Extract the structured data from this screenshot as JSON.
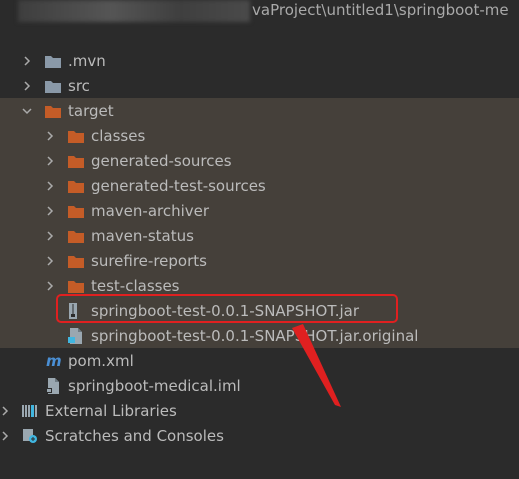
{
  "header": {
    "path_text": "vaProject\\untitled1\\springboot-me"
  },
  "tree": {
    "mvn": ".mvn",
    "src": "src",
    "target": "target",
    "classes": "classes",
    "generated_sources": "generated-sources",
    "generated_test_sources": "generated-test-sources",
    "maven_archiver": "maven-archiver",
    "maven_status": "maven-status",
    "surefire_reports": "surefire-reports",
    "test_classes": "test-classes",
    "jar": "springboot-test-0.0.1-SNAPSHOT.jar",
    "jar_original": "springboot-test-0.0.1-SNAPSHOT.jar.original",
    "pom": "pom.xml",
    "iml": "springboot-medical.iml",
    "external_libraries": "External Libraries",
    "scratches": "Scratches and Consoles"
  },
  "icons": {
    "folder": "folder-icon",
    "excluded_folder": "excluded-folder-icon",
    "jar": "jar-icon",
    "file": "file-icon",
    "maven": "maven-icon",
    "iml": "iml-icon",
    "library": "library-icon",
    "scratches": "scratches-icon"
  },
  "colors": {
    "background": "#2b2b2b",
    "excluded_row": "#45403a",
    "orange_folder": "#c45c27",
    "gray_folder": "#8a99a8",
    "highlight_red": "#e02020"
  }
}
